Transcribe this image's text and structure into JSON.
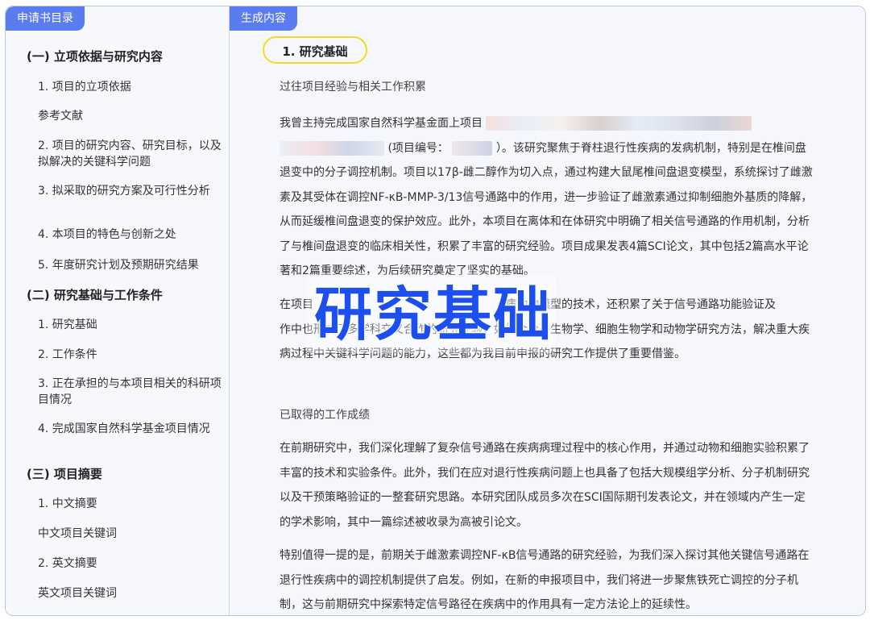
{
  "sidebar": {
    "tab": "申请书目录",
    "items": [
      {
        "label": "(一) 立项依据与研究内容",
        "level": 0
      },
      {
        "label": "1. 项目的立项依据",
        "level": 1
      },
      {
        "label": "参考文献",
        "level": 1
      },
      {
        "label": "2. 项目的研究内容、研究目标，以及拟解决的关键科学问题",
        "level": 1
      },
      {
        "label": "3. 拟采取的研究方案及可行性分析",
        "level": 1
      },
      {
        "label": "4. 本项目的特色与创新之处",
        "level": 1
      },
      {
        "label": "5. 年度研究计划及预期研究结果",
        "level": 1
      },
      {
        "label": "(二) 研究基础与工作条件",
        "level": 0
      },
      {
        "label": "1. 研究基础",
        "level": 1
      },
      {
        "label": "2. 工作条件",
        "level": 1
      },
      {
        "label": "3. 正在承担的与本项目相关的科研项目情况",
        "level": 1
      },
      {
        "label": "4. 完成国家自然科学基金项目情况",
        "level": 1
      },
      {
        "label": "(三) 项目摘要",
        "level": 0
      },
      {
        "label": "1. 中文摘要",
        "level": 1
      },
      {
        "label": "中文项目关键词",
        "level": 1
      },
      {
        "label": "2. 英文摘要",
        "level": 1
      },
      {
        "label": "英文项目关键词",
        "level": 1
      }
    ]
  },
  "main": {
    "tab": "生成内容",
    "heading": "1. 研究基础",
    "sub1": "过往项目经验与相关工作积累",
    "p1_start": "我曾主持完成国家自然科学基金面上项目",
    "p1_code_label": "(项目编号：",
    "p1_rest": "）。该研究聚焦于脊柱退行性疾病的发病机制，特别是在椎间盘退变中的分子调控机制。项目以17β-雌二醇作为切入点，通过构建大鼠尾椎间盘退变模型，系统探讨了雌激素及其受体在调控NF-κB-MMP-3/13信号通路中的作用，进一步验证了雌激素通过抑制细胞外基质的降解，从而延缓椎间盘退变的保护效应。此外，本项目在离体和在体研究中明确了相关信号通路的作用机制，分析了与椎间盘退变的临床相关性，积累了丰富的研究经验。项目成果发表4篇SCI论文，其中包括2篇高水平论著和2篇重要综述，为后续研究奠定了坚实的基础。",
    "p2": "在项目　　　　　　　　　　　　　　　　　病动物模型的技术，还积累了关于信号通路功能验证及　　　　　　　　　　　　　　　　　作中也形成了多学科交叉合作的研究经验，如结合分子生物学、细胞生物学和动物学研究方法，解决重大疾病过程中关键科学问题的能力，这些都为我目前申报的研究工作提供了重要借鉴。",
    "sub2": "已取得的工作成绩",
    "p3": "在前期研究中，我们深化理解了复杂信号通路在疾病病理过程中的核心作用，并通过动物和细胞实验积累了丰富的技术和实验条件。此外，我们在应对退行性疾病问题上也具备了包括大规模组学分析、分子机制研究以及干预策略验证的一整套研究思路。本研究团队成员多次在SCI国际期刊发表论文，并在领域内产生一定的学术影响，其中一篇综述被收录为高被引论文。",
    "p4": "特别值得一提的是，前期关于雌激素调控NF-κB信号通路的研究经验，为我们深入探讨其他关键信号通路在退行性疾病中的调控机制提供了启发。例如，在新的申报项目中，我们将进一步聚焦铁死亡调控的分子机制，这与前期研究中探索特定信号路径在疾病中的作用具有一定方法论上的延续性。"
  },
  "overlay": {
    "text": "研究基础"
  }
}
